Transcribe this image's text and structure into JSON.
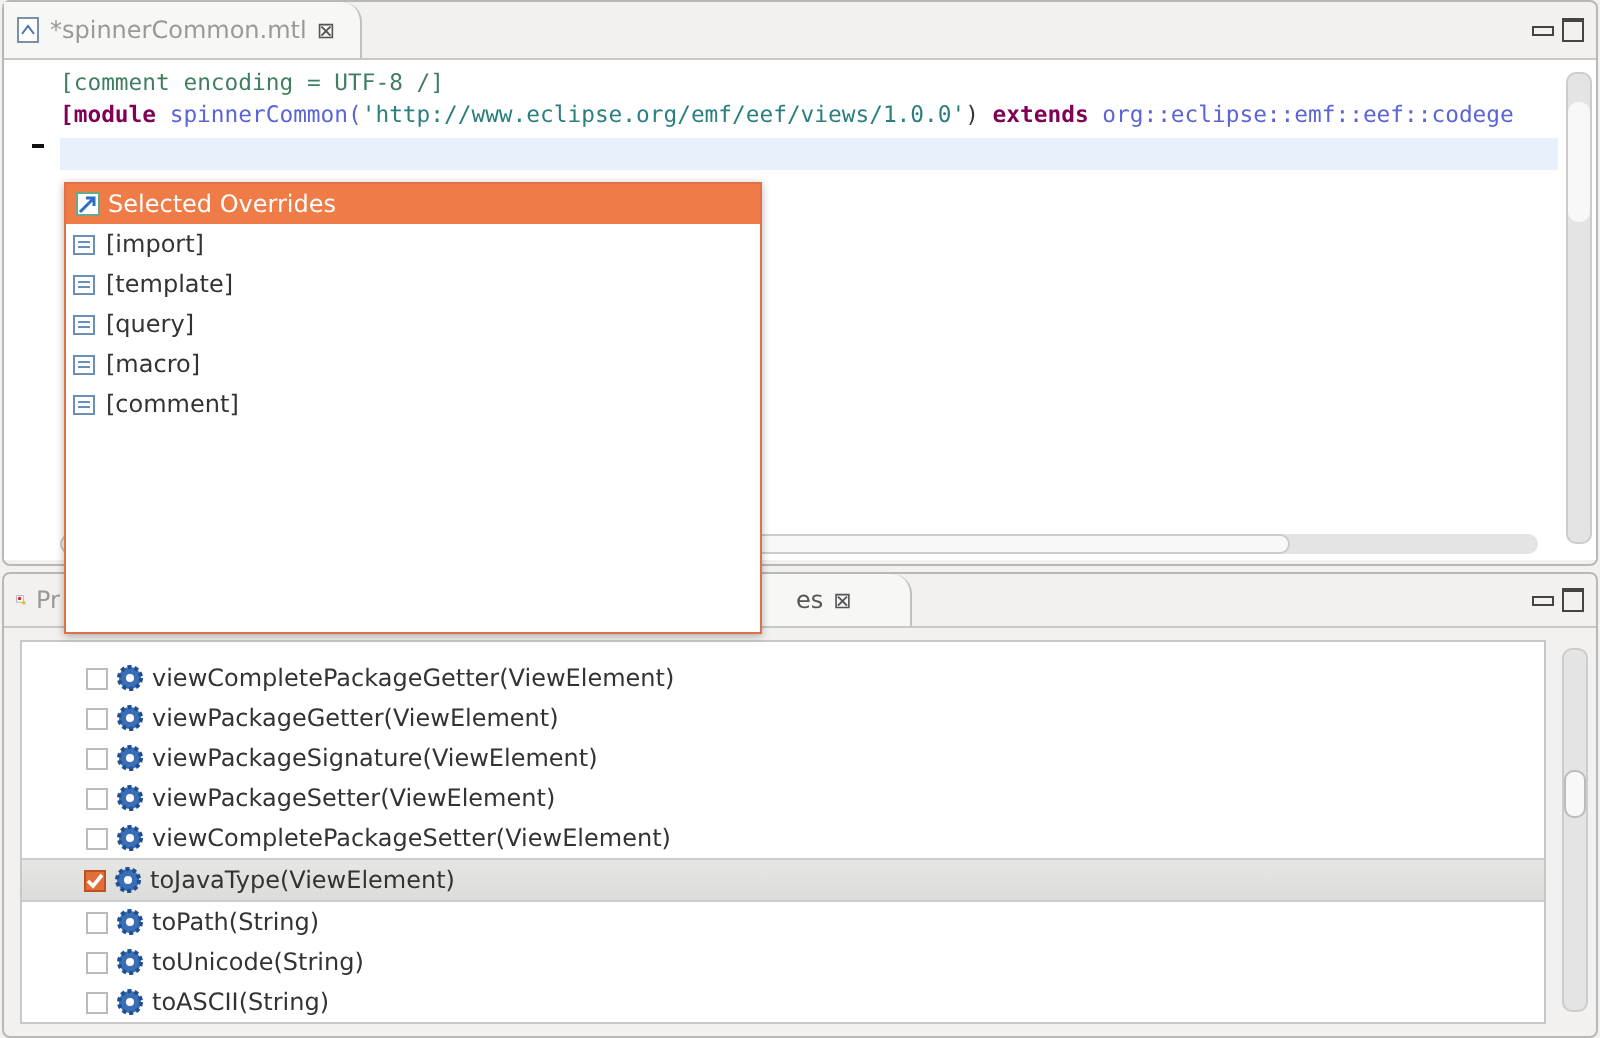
{
  "editor": {
    "tab": {
      "title": "*spinnerCommon.mtl",
      "close": "⊠"
    },
    "lines": [
      {
        "current": false,
        "tokens": [
          {
            "kind": "comment",
            "text": "[comment encoding = UTF-8 /]"
          }
        ]
      },
      {
        "current": false,
        "tokens": [
          {
            "kind": "keyword",
            "text": "[module"
          },
          {
            "kind": "name",
            "text": "spinnerCommon("
          },
          {
            "kind": "string",
            "text": "'http://www.eclipse.org/emf/eef/views/1.0.0'"
          },
          {
            "kind": "plain",
            "text": ")"
          },
          {
            "kind": "keyword",
            "text": "extends"
          },
          {
            "kind": "name",
            "text": "org::eclipse::emf::eef::codege"
          }
        ]
      },
      {
        "current": true
      }
    ]
  },
  "popup": {
    "title": "Selected Overrides",
    "items": [
      "[import]",
      "[template]",
      "[query]",
      "[macro]",
      "[comment]"
    ]
  },
  "bottom_panel": {
    "tabs": [
      {
        "label": "Pr",
        "selected": false
      },
      {
        "label": "es",
        "selected": true,
        "close": "⊠"
      }
    ],
    "items": [
      {
        "label": "viewCompletePackageGetter(ViewElement)",
        "checked": false,
        "selected": false
      },
      {
        "label": "viewPackageGetter(ViewElement)",
        "checked": false,
        "selected": false
      },
      {
        "label": "viewPackageSignature(ViewElement)",
        "checked": false,
        "selected": false
      },
      {
        "label": "viewPackageSetter(ViewElement)",
        "checked": false,
        "selected": false
      },
      {
        "label": "viewCompletePackageSetter(ViewElement)",
        "checked": false,
        "selected": false
      },
      {
        "label": "toJavaType(ViewElement)",
        "checked": true,
        "selected": true
      },
      {
        "label": "toPath(String)",
        "checked": false,
        "selected": false
      },
      {
        "label": "toUnicode(String)",
        "checked": false,
        "selected": false
      },
      {
        "label": "toASCII(String)",
        "checked": false,
        "selected": false
      }
    ]
  }
}
